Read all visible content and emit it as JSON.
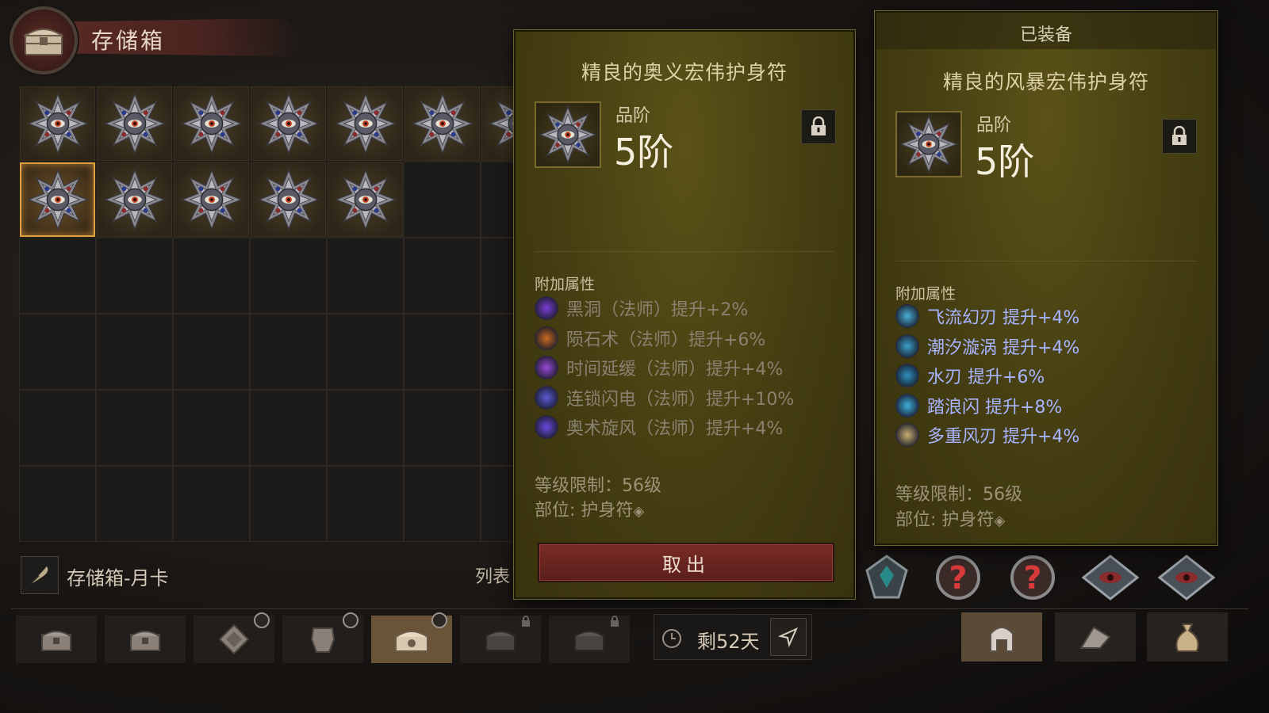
{
  "storage": {
    "title": "存储箱",
    "name": "存储箱-月卡",
    "list_label": "列表",
    "rows": [
      {
        "filled": 7
      },
      {
        "filled": 5
      }
    ]
  },
  "tabbar": {
    "days_left": "剩52天"
  },
  "compare_item": {
    "title": "精良的奥义宏伟护身符",
    "grade_label": "品阶",
    "grade_value": "5阶",
    "section_label": "附加属性",
    "attributes": [
      {
        "text": "黑洞（法师）提升+2%",
        "icon_color": "#7b3fd6"
      },
      {
        "text": "陨石术（法师）提升+6%",
        "icon_color": "#c86a20"
      },
      {
        "text": "时间延缓（法师）提升+4%",
        "icon_color": "#9a4ad8"
      },
      {
        "text": "连锁闪电（法师）提升+10%",
        "icon_color": "#5a5ad8"
      },
      {
        "text": "奥术旋风（法师）提升+4%",
        "icon_color": "#6a4ae0"
      }
    ],
    "level_req": "等级限制：56级",
    "slot": "部位: 护身符",
    "take_button": "取出"
  },
  "equipped_item": {
    "header": "已装备",
    "title": "精良的风暴宏伟护身符",
    "grade_label": "品阶",
    "grade_value": "5阶",
    "section_label": "附加属性",
    "attributes": [
      {
        "text": "飞流幻刃  提升+4%",
        "icon_color": "#4ab0d8"
      },
      {
        "text": "潮汐漩涡  提升+4%",
        "icon_color": "#3aa0c8"
      },
      {
        "text": "水刃  提升+6%",
        "icon_color": "#2a90c0"
      },
      {
        "text": "踏浪闪  提升+8%",
        "icon_color": "#3ab0e0"
      },
      {
        "text": "多重风刃  提升+4%",
        "icon_color": "#c8b070"
      }
    ],
    "level_req": "等级限制：56级",
    "slot": "部位: 护身符"
  },
  "colors": {
    "panel_bg": "#463f12",
    "take_button": "#6a2420",
    "selected_border": "#e0a040"
  }
}
